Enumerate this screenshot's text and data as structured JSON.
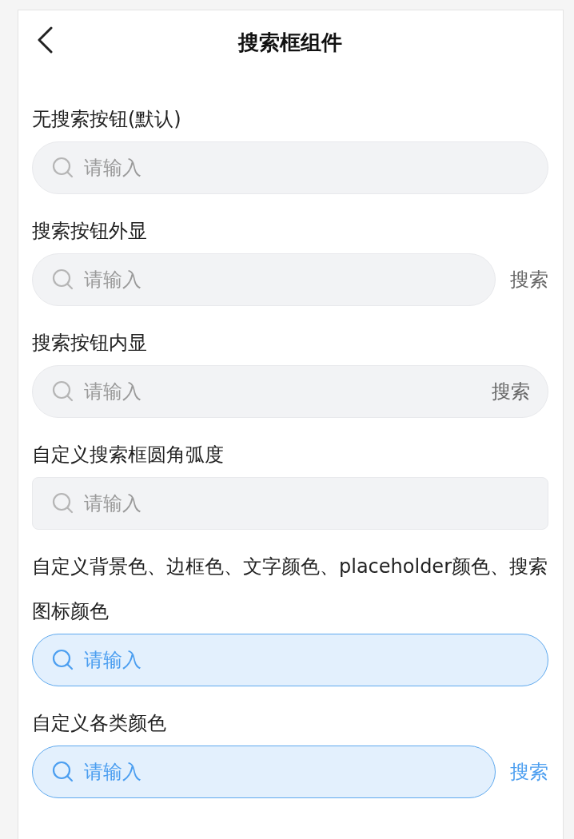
{
  "nav": {
    "title": "搜索框组件"
  },
  "sections": [
    {
      "label": "无搜索按钮(默认)",
      "field": {
        "kind": "round",
        "placeholder": "请输入",
        "tinted": false
      }
    },
    {
      "label": "搜索按钮外显",
      "field": {
        "kind": "round",
        "placeholder": "请输入",
        "tinted": false
      },
      "button": {
        "kind": "outside",
        "text": "搜索"
      }
    },
    {
      "label": "搜索按钮内显",
      "field": {
        "kind": "round",
        "placeholder": "请输入",
        "tinted": false
      },
      "button": {
        "kind": "inside",
        "text": "搜索"
      }
    },
    {
      "label": "自定义搜索框圆角弧度",
      "field": {
        "kind": "square",
        "placeholder": "请输入",
        "tinted": false
      }
    },
    {
      "label": "自定义背景色、边框色、文字颜色、placeholder颜色、搜索图标颜色",
      "field": {
        "kind": "round",
        "placeholder": "请输入",
        "tinted": true
      }
    },
    {
      "label": "自定义各类颜色",
      "field": {
        "kind": "round",
        "placeholder": "请输入",
        "tinted": true
      },
      "button": {
        "kind": "outside",
        "text": "搜索"
      }
    }
  ]
}
